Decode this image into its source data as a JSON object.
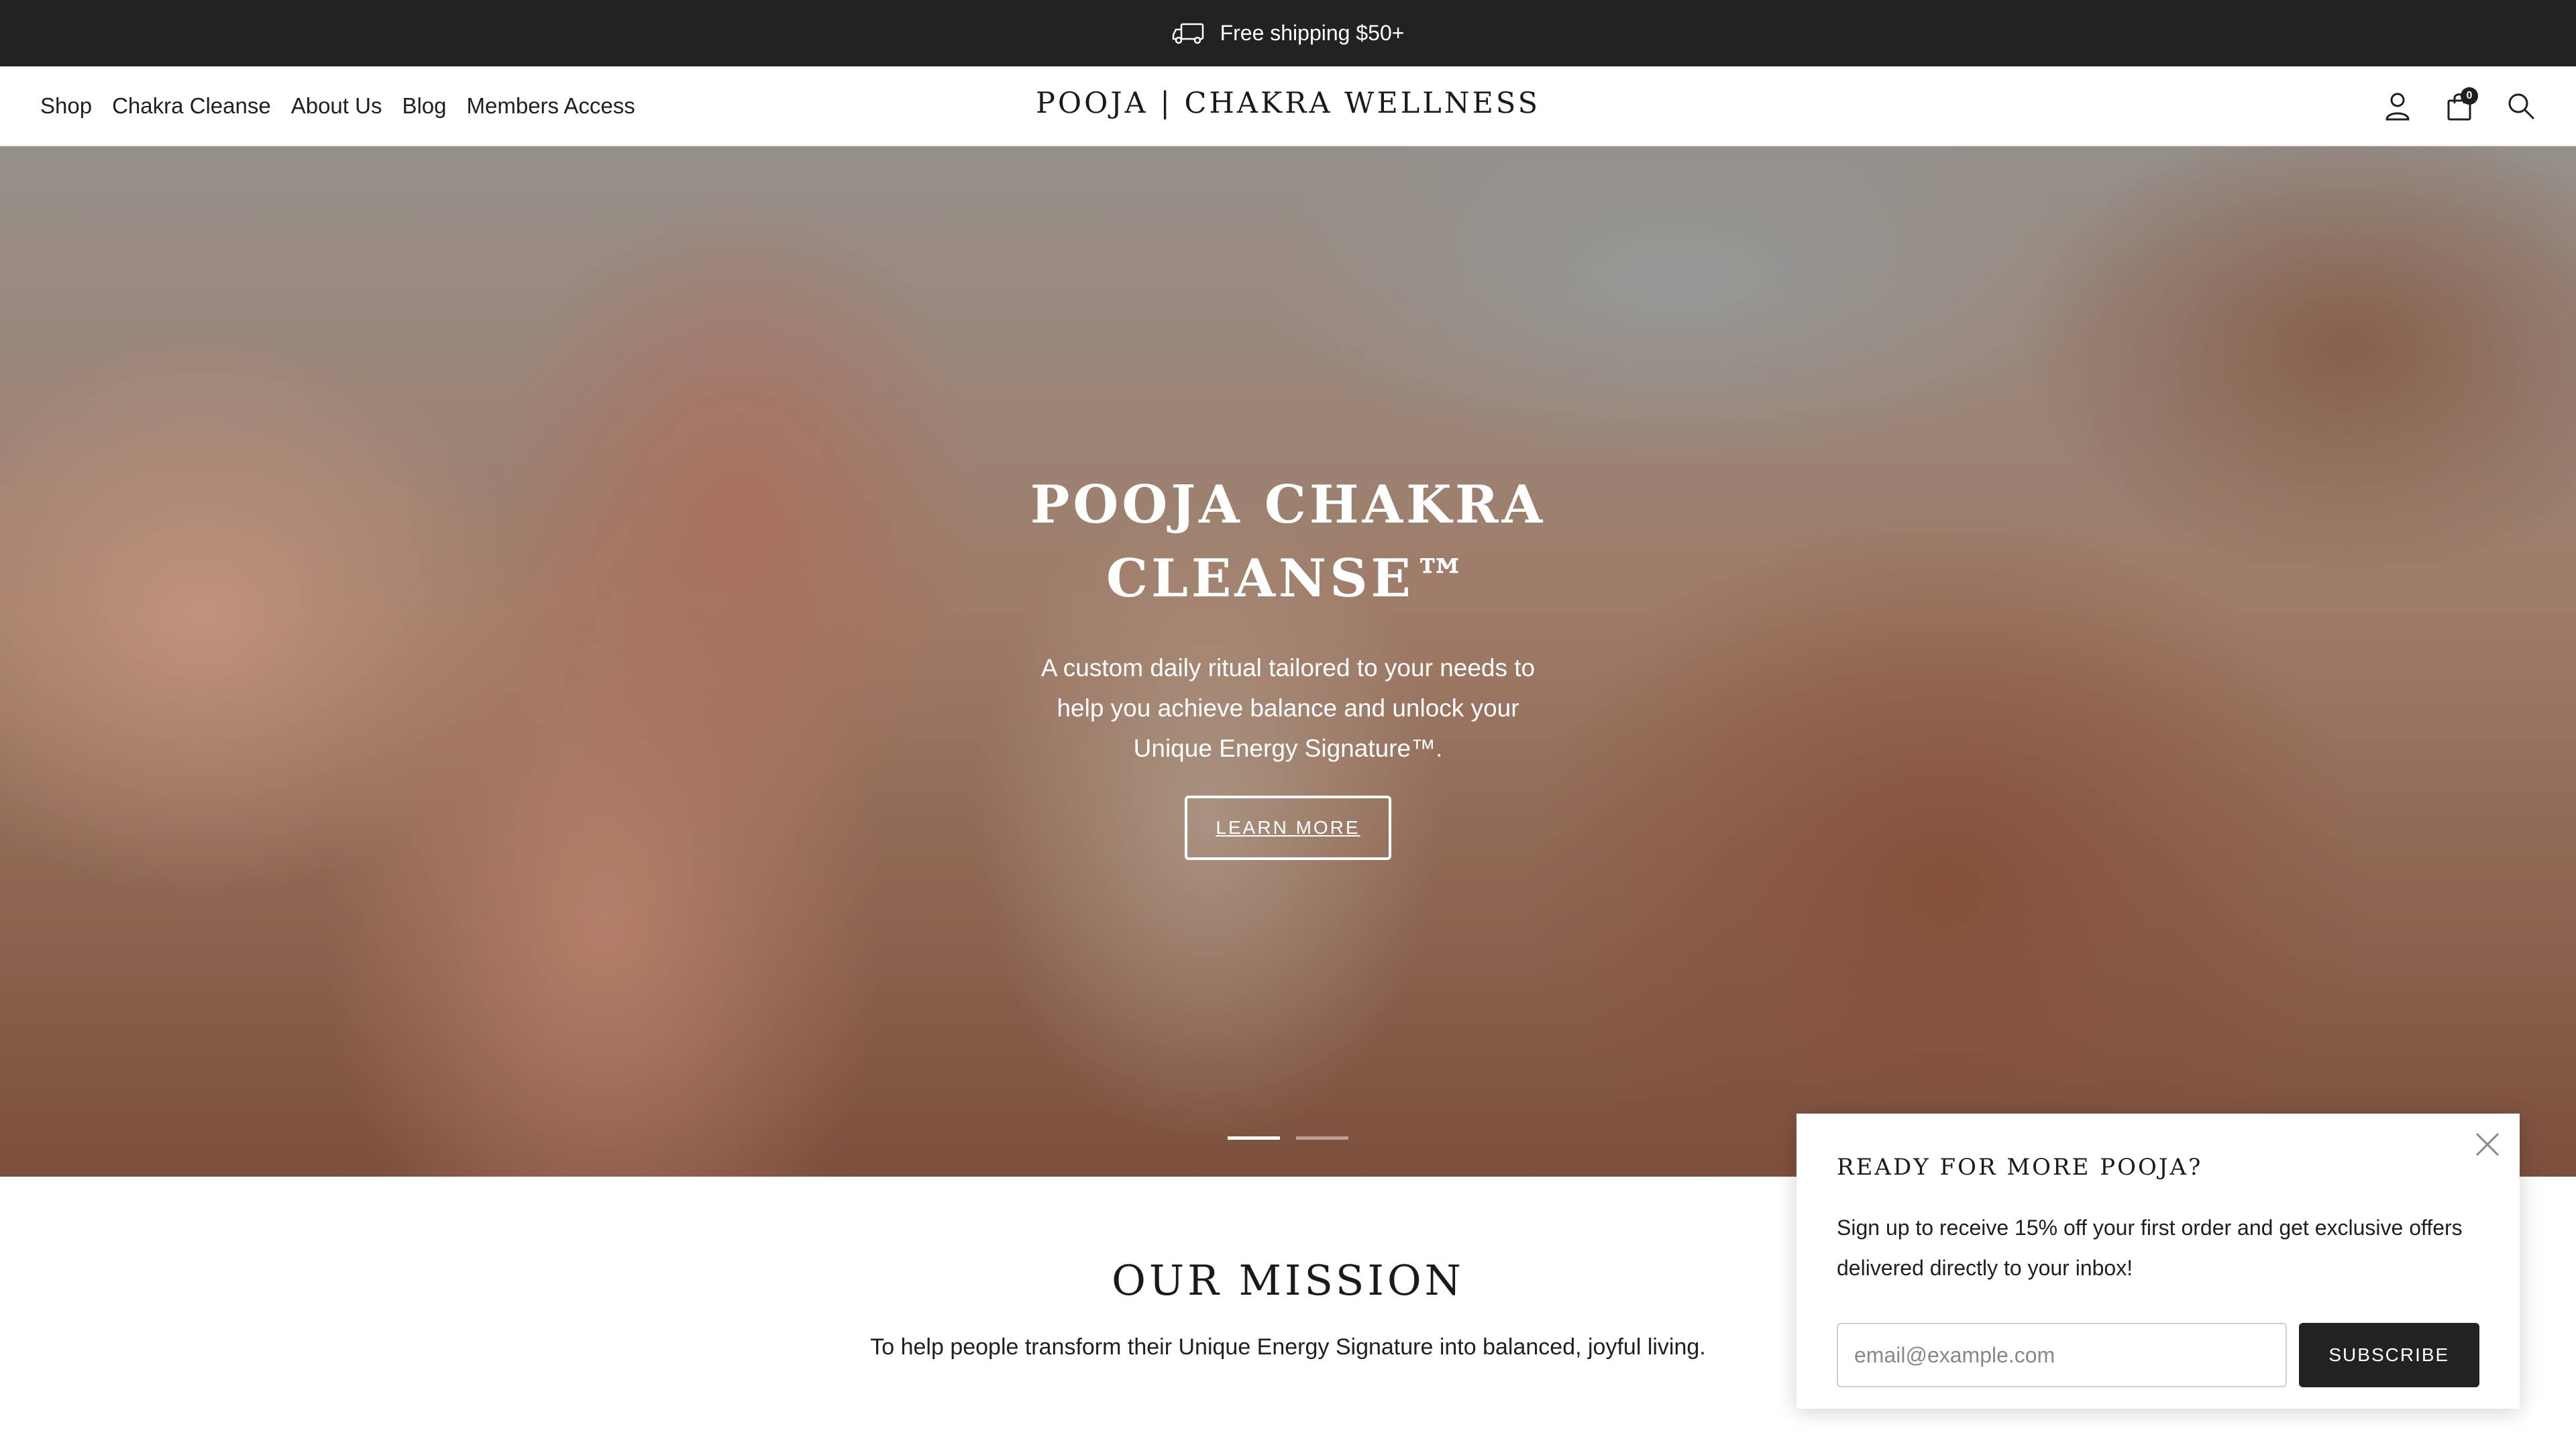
{
  "announcement": {
    "text": "Free shipping $50+",
    "icon": "truck-icon"
  },
  "header": {
    "nav": [
      "Shop",
      "Chakra Cleanse",
      "About Us",
      "Blog",
      "Members Access"
    ],
    "logo": "POOJA | CHAKRA WELLNESS",
    "icons": [
      "account-icon",
      "cart-icon",
      "search-icon"
    ],
    "cart_count": "0"
  },
  "hero": {
    "title_line1": "POOJA CHAKRA",
    "title_line2": "CLEANSE™",
    "subtitle": "A custom daily ritual tailored to your needs to help you achieve balance and unlock your Unique Energy Signature™.",
    "button_label": "LEARN MORE",
    "slides": 2,
    "active_slide": 1
  },
  "mission": {
    "title": "OUR MISSION",
    "text": "To help people transform their Unique Energy Signature into balanced, joyful living."
  },
  "popup": {
    "title": "READY FOR MORE POOJA?",
    "text": "Sign up to receive 15% off your first order and get exclusive offers delivered directly to your inbox!",
    "email_placeholder": "email@example.com",
    "button_label": "SUBSCRIBE"
  }
}
